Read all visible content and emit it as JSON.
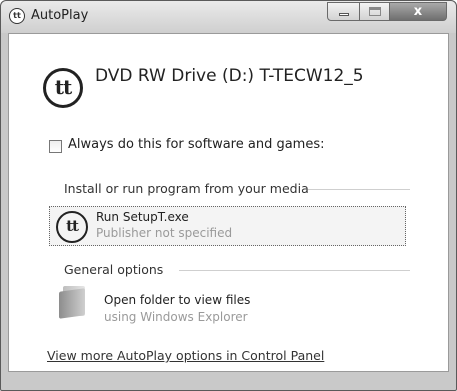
{
  "window": {
    "title": "AutoPlay",
    "icon_text": "tt",
    "close_glyph": "x"
  },
  "drive": {
    "icon_text": "tt",
    "title": "DVD RW Drive (D:) T-TECW12_5"
  },
  "checkbox": {
    "label": "Always do this for software and games:",
    "checked": false
  },
  "install_section": {
    "heading": "Install or run program from your media",
    "program": {
      "icon_text": "tt",
      "name": "Run SetupT.exe",
      "publisher": "Publisher not specified"
    }
  },
  "general_section": {
    "heading": "General options",
    "folder": {
      "icon": "folder-icon",
      "label": "Open folder to view files",
      "sub": "using Windows Explorer"
    }
  },
  "link": {
    "text": "View more AutoPlay options in Control Panel"
  }
}
